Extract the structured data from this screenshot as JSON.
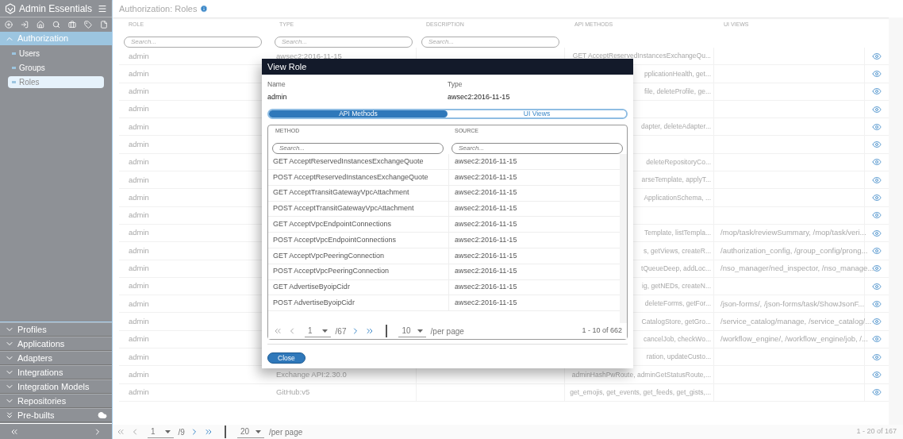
{
  "sidebar": {
    "title": "Admin Essentials",
    "sections": [
      {
        "label": "Authorization",
        "expanded": true,
        "kind": "local",
        "items": [
          {
            "label": "Users",
            "selected": false
          },
          {
            "label": "Groups",
            "selected": false
          },
          {
            "label": "Roles",
            "selected": true
          }
        ]
      },
      {
        "label": "Profiles",
        "expanded": false,
        "kind": "local"
      },
      {
        "label": "Applications",
        "expanded": false,
        "kind": "local"
      },
      {
        "label": "Adapters",
        "expanded": false,
        "kind": "local"
      },
      {
        "label": "Integrations",
        "expanded": false,
        "kind": "local"
      },
      {
        "label": "Integration Models",
        "expanded": false,
        "kind": "local"
      },
      {
        "label": "Repositories",
        "expanded": false,
        "kind": "local"
      },
      {
        "label": "Pre-builts",
        "expanded": false,
        "kind": "remote"
      }
    ]
  },
  "page": {
    "title": "Authorization: Roles",
    "table": {
      "columns": [
        {
          "label": "ROLE",
          "placeholder": "Search..."
        },
        {
          "label": "TYPE",
          "placeholder": "Search..."
        },
        {
          "label": "DESCRIPTION",
          "placeholder": "Search..."
        },
        {
          "label": "API METHODS"
        },
        {
          "label": "UI VIEWS"
        }
      ],
      "rows": [
        {
          "role": "admin",
          "type": "awsec2:2016-11-15",
          "api_methods": "GET AcceptReservedInstancesExchangeQu..."
        },
        {
          "role": "admin",
          "api_methods": "pplicationHealth, get..."
        },
        {
          "role": "admin",
          "api_methods": "file, deleteProfile, ge..."
        },
        {
          "role": "admin"
        },
        {
          "role": "admin",
          "api_methods": "dapter, deleteAdapter..."
        },
        {
          "role": "admin"
        },
        {
          "role": "admin",
          "api_methods": "deleteRepositoryCo..."
        },
        {
          "role": "admin",
          "api_methods": "arseTemplate, applyT..."
        },
        {
          "role": "admin",
          "api_methods": "ApplicationSchema, ..."
        },
        {
          "role": "admin"
        },
        {
          "role": "admin",
          "api_methods": "Template, listTempla...",
          "ui_views": "/mop/task/reviewSummary, /mop/task/veri..."
        },
        {
          "role": "admin",
          "api_methods": "s, getViews, createR...",
          "ui_views": "/authorization_config, /group_config/prong..."
        },
        {
          "role": "admin",
          "api_methods": "tQueueDeep, addLoc...",
          "ui_views": "/nso_manager/ned_inspector, /nso_manage..."
        },
        {
          "role": "admin",
          "api_methods": "ig, getNEDs, createN..."
        },
        {
          "role": "admin",
          "api_methods": "deleteForms, getFor...",
          "ui_views": "/json-forms/, /json-forms/task/ShowJsonF..."
        },
        {
          "role": "admin",
          "api_methods": "CatalogStore, getGro...",
          "ui_views": "/service_catalog/manage, /service_catalog/..."
        },
        {
          "role": "admin",
          "api_methods": "cancelJob, checkWo...",
          "ui_views": "/workflow_engine/, /workflow_engine/job, /..."
        },
        {
          "role": "admin",
          "api_methods": "ration, updateCusto..."
        },
        {
          "role": "admin",
          "type": "Exchange API:2.30.0",
          "api_methods": "adminHashPwRoute, adminGetStatusRoute,..."
        },
        {
          "role": "admin",
          "type": "GitHub:v5",
          "api_methods": "get_emojis, get_events, get_feeds, get_gists,..."
        }
      ]
    },
    "pagination": {
      "page": "1",
      "pages": "/9",
      "per_page": "20",
      "per_page_label": "/per page",
      "range": "1 - 20 of 167",
      "prev_disabled": true,
      "next_disabled": false
    }
  },
  "modal": {
    "title": "View Role",
    "fields": [
      {
        "label": "Name",
        "value": "admin"
      },
      {
        "label": "Type",
        "value": "awsec2:2016-11-15"
      }
    ],
    "tabs": [
      {
        "label": "API Methods",
        "selected": true
      },
      {
        "label": "UI Views",
        "selected": false
      }
    ],
    "table": {
      "columns": [
        {
          "label": "METHOD",
          "placeholder": "Search..."
        },
        {
          "label": "SOURCE",
          "placeholder": "Search..."
        }
      ],
      "rows": [
        {
          "method": "GET AcceptReservedInstancesExchangeQuote",
          "source": "awsec2:2016-11-15"
        },
        {
          "method": "POST AcceptReservedInstancesExchangeQuote",
          "source": "awsec2:2016-11-15"
        },
        {
          "method": "GET AcceptTransitGatewayVpcAttachment",
          "source": "awsec2:2016-11-15"
        },
        {
          "method": "POST AcceptTransitGatewayVpcAttachment",
          "source": "awsec2:2016-11-15"
        },
        {
          "method": "GET AcceptVpcEndpointConnections",
          "source": "awsec2:2016-11-15"
        },
        {
          "method": "POST AcceptVpcEndpointConnections",
          "source": "awsec2:2016-11-15"
        },
        {
          "method": "GET AcceptVpcPeeringConnection",
          "source": "awsec2:2016-11-15"
        },
        {
          "method": "POST AcceptVpcPeeringConnection",
          "source": "awsec2:2016-11-15"
        },
        {
          "method": "GET AdvertiseByoipCidr",
          "source": "awsec2:2016-11-15"
        },
        {
          "method": "POST AdvertiseByoipCidr",
          "source": "awsec2:2016-11-15"
        }
      ]
    },
    "pagination": {
      "page": "1",
      "pages": "/67",
      "per_page": "10",
      "per_page_label": "/per page",
      "range": "1 - 10 of 662",
      "prev_disabled": true,
      "next_disabled": false
    },
    "close_button": "Close"
  }
}
